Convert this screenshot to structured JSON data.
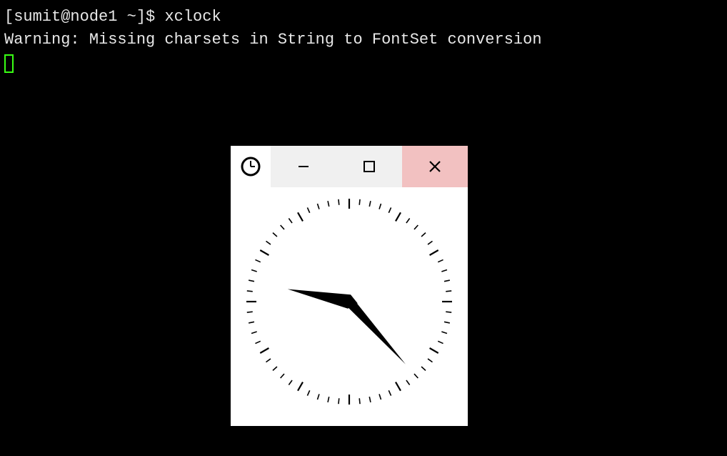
{
  "terminal": {
    "prompt": "[sumit@node1 ~]$",
    "command": "xclock",
    "warning": "Warning: Missing charsets in String to FontSet conversion"
  },
  "window": {
    "app": "xclock",
    "clock": {
      "hour": 9,
      "minute": 23
    },
    "buttons": {
      "minimize": "minimize",
      "maximize": "maximize",
      "close": "close"
    }
  }
}
